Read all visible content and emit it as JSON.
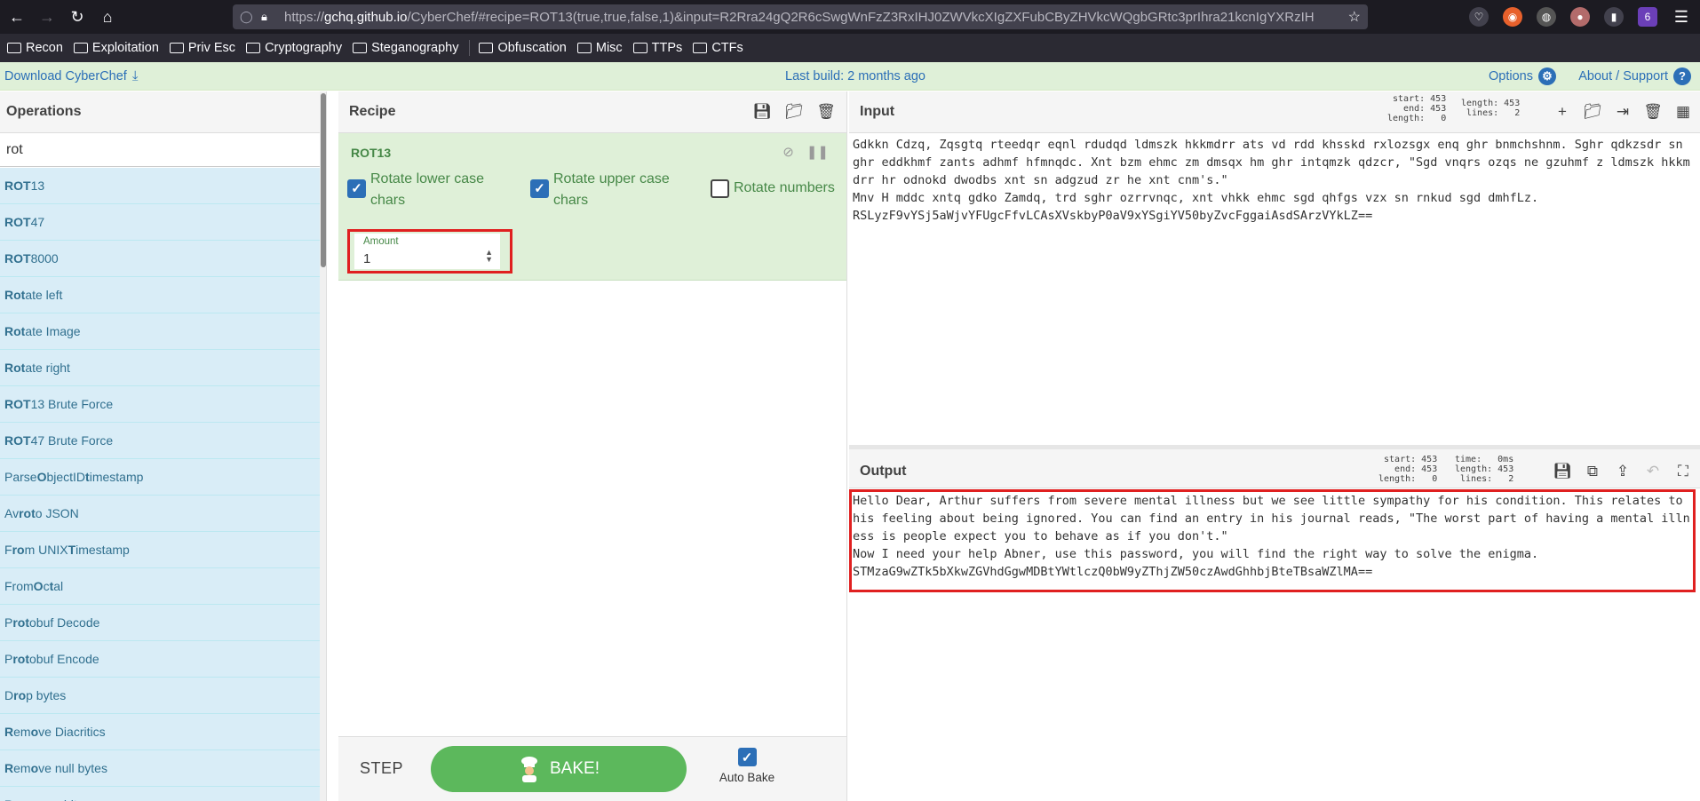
{
  "browser": {
    "url_prefix": "https://",
    "url_host": "gchq.github.io",
    "url_rest": "/CyberChef/#recipe=ROT13(true,true,false,1)&input=R2Rra24gQ2R6cSwgWnFzZ3RxIHJ0ZWVkcXIgZXFubCByZHVkcWQgbGRtc3prIhra21kcnIgYXRzIH",
    "bookmarks": [
      "Recon",
      "Exploitation",
      "Priv Esc",
      "Cryptography",
      "Steganography",
      "Obfuscation",
      "Misc",
      "TTPs",
      "CTFs"
    ],
    "ext_badge": "6"
  },
  "banner": {
    "download": "Download CyberChef",
    "last_build": "Last build: 2 months ago",
    "options": "Options",
    "about": "About / Support"
  },
  "operations": {
    "title": "Operations",
    "search_value": "rot",
    "items": [
      {
        "bold": "ROT",
        "rest": "13"
      },
      {
        "bold": "ROT",
        "rest": "47"
      },
      {
        "bold": "ROT",
        "rest": "8000"
      },
      {
        "bold": "Rot",
        "rest": "ate left"
      },
      {
        "bold": "Rot",
        "rest": "ate Image"
      },
      {
        "bold": "Rot",
        "rest": "ate right"
      },
      {
        "bold": "ROT",
        "rest": "13 Brute Force"
      },
      {
        "bold": "ROT",
        "rest": "47 Brute Force"
      },
      {
        "pre": "Parse ",
        "bold": "O",
        "rest": "bjectID ",
        "bold2": "t",
        "rest2": "imestamp"
      },
      {
        "pre": "Av",
        "bold": "ro",
        "rest": " ",
        "bold2": "t",
        "rest2": "o JSON"
      },
      {
        "pre": "F",
        "bold": "ro",
        "rest": "m UNIX ",
        "bold2": "T",
        "rest2": "imestamp"
      },
      {
        "pre": "From ",
        "bold": "O",
        "rest": "c",
        "bold2": "t",
        "rest2": "al"
      },
      {
        "pre": "P",
        "bold": "ro",
        "rest": "",
        "bold2": "t",
        "rest2": "obuf Decode"
      },
      {
        "pre": "P",
        "bold": "ro",
        "rest": "",
        "bold2": "t",
        "rest2": "obuf Encode"
      },
      {
        "pre": "D",
        "bold": "ro",
        "rest": "p bytes"
      },
      {
        "pre": "",
        "bold": "R",
        "rest": "em",
        "bold2": "o",
        "rest2": "ve Diacritics"
      },
      {
        "pre": "",
        "bold": "R",
        "rest": "em",
        "bold2": "o",
        "rest2": "ve null bytes"
      },
      {
        "pre": "",
        "bold": "R",
        "rest": "em",
        "bold2": "o",
        "rest2": "ve whitespace"
      }
    ]
  },
  "recipe": {
    "title": "Recipe",
    "op_name": "ROT13",
    "opt_lower": "Rotate lower case chars",
    "opt_upper": "Rotate upper case chars",
    "opt_numbers": "Rotate numbers",
    "amount_label": "Amount",
    "amount_value": "1",
    "step": "STEP",
    "bake": "BAKE!",
    "autobake": "Auto Bake"
  },
  "input": {
    "title": "Input",
    "stats_left": "start: 453\n  end: 453\nlength:   0",
    "stats_right": "length: 453\n lines:   2",
    "text": "Gdkkn Cdzq, Zqsgtq rteedqr eqnl rdudqd ldmszk hkkmdrr ats vd rdd khsskd rxlozsgx enq ghr bnmchshnm. Sghr qdkzsdr sn ghr eddkhmf zants adhmf hfmnqdc. Xnt bzm ehmc zm dmsqx hm ghr intqmzk qdzcr, \"Sgd vnqrs ozqs ne gzuhmf z ldmszk hkkmdrr hr odnokd dwodbs xnt sn adgzud zr he xnt cnm's.\"\nMnv H mddc xntq gdko Zamdq, trd sghr ozrrvnqc, xnt vhkk ehmc sgd qhfgs vzx sn rnkud sgd dmhfLz.\nRSLyzF9vYSj5aWjvYFUgcFfvLCAsXVskbyP0aV9xYSgiYV50byZvcFggaiAsdSArzVYkLZ=="
  },
  "output": {
    "title": "Output",
    "stats_left": "start: 453\n  end: 453\nlength:   0",
    "stats_right": "time:   0ms\nlength: 453\n lines:   2",
    "text": "Hello Dear, Arthur suffers from severe mental illness but we see little sympathy for his condition. This relates to his feeling about being ignored. You can find an entry in his journal reads, \"The worst part of having a mental illness is people expect you to behave as if you don't.\"\nNow I need your help Abner, use this password, you will find the right way to solve the enigma.\nSTMzaG9wZTk5bXkwZGVhdGgwMDBtYWtlczQ0bW9yZThjZW50czAwdGhhbjBteTBsaWZlMA=="
  }
}
